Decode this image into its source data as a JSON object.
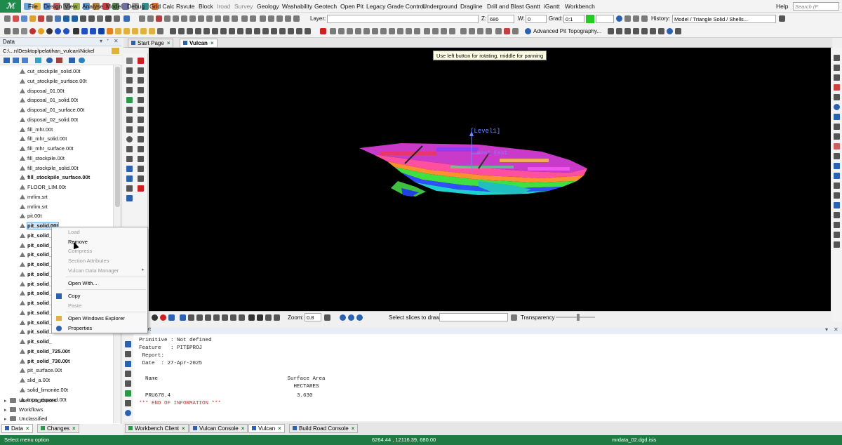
{
  "menu": {
    "items": [
      "File",
      "Design",
      "View",
      "Analyse",
      "Model",
      "Debug",
      "Grid Calc",
      "Rsvute",
      "Block",
      "Iroad",
      "Survey",
      "Geology",
      "Washability",
      "Geotech",
      "Open Pit",
      "Legacy Grade Control",
      "Underground",
      "Dragline",
      "Drill and Blast",
      "Gantt",
      "iGantt",
      "Workbench"
    ],
    "help": "Help",
    "search_placeholder": "Search (F"
  },
  "toolbar1": {
    "layer_label": "Layer:",
    "z_label": "Z:",
    "z_value": "680",
    "w_label": "W:",
    "w_value": "0",
    "grad_label": "Grad:",
    "grad_value": "0:1",
    "history_label": "History:",
    "history_value": "Model / Triangle Solid / Shells..."
  },
  "toolbar2": {
    "advanced_pit": "Advanced Pit Topography..."
  },
  "data_panel": {
    "title": "Data",
    "path": "C:\\...n\\Desktop\\pelatihan_vulcan\\Nickel",
    "files": [
      {
        "name": "cut_stockpile_solid.00t",
        "bold": false
      },
      {
        "name": "cut_stockpile_surface.00t",
        "bold": false
      },
      {
        "name": "disposal_01.00t",
        "bold": false
      },
      {
        "name": "disposal_01_solid.00t",
        "bold": false
      },
      {
        "name": "disposal_01_surface.00t",
        "bold": false
      },
      {
        "name": "disposal_02_solid.00t",
        "bold": false
      },
      {
        "name": "fill_mhr.00t",
        "bold": false
      },
      {
        "name": "fill_mhr_solid.00t",
        "bold": false
      },
      {
        "name": "fill_mhr_surface.00t",
        "bold": false
      },
      {
        "name": "fill_stockpile.00t",
        "bold": false
      },
      {
        "name": "fill_stockpile_solid.00t",
        "bold": false
      },
      {
        "name": "fill_stockpile_surface.00t",
        "bold": true
      },
      {
        "name": "FLOOR_LIM.00t",
        "bold": false
      },
      {
        "name": "mrlim.srt",
        "bold": false
      },
      {
        "name": "mrlim.srt",
        "bold": false
      },
      {
        "name": "pit.00t",
        "bold": false
      },
      {
        "name": "pit_solid.00t",
        "bold": true,
        "selected": true
      },
      {
        "name": "pit_solid_",
        "bold": true
      },
      {
        "name": "pit_solid_",
        "bold": true
      },
      {
        "name": "pit_solid_",
        "bold": true
      },
      {
        "name": "pit_solid_",
        "bold": true
      },
      {
        "name": "pit_solid_",
        "bold": true
      },
      {
        "name": "pit_solid_",
        "bold": true
      },
      {
        "name": "pit_solid_",
        "bold": true
      },
      {
        "name": "pit_solid_",
        "bold": true
      },
      {
        "name": "pit_solid_",
        "bold": true
      },
      {
        "name": "pit_solid_",
        "bold": true
      },
      {
        "name": "pit_solid_",
        "bold": true
      },
      {
        "name": "pit_solid_",
        "bold": true
      },
      {
        "name": "pit_solid_725.00t",
        "bold": true
      },
      {
        "name": "pit_solid_730.00t",
        "bold": true
      },
      {
        "name": "pit_surface.00t",
        "bold": false
      },
      {
        "name": "slid_a.00t",
        "bold": false
      },
      {
        "name": "solid_limonite.00t",
        "bold": false
      },
      {
        "name": "topo_expand.00t",
        "bold": false
      }
    ],
    "folders": [
      "User Databases",
      "Workflows",
      "Unclassified"
    ],
    "tabs": [
      "Data",
      "Changes"
    ]
  },
  "context_menu": {
    "items": [
      {
        "label": "Load",
        "disabled": true
      },
      {
        "label": "Remove",
        "disabled": false
      },
      {
        "label": "Compress",
        "disabled": true
      },
      {
        "label": "Section Attributes",
        "disabled": true
      },
      {
        "label": "Vulcan Data Manager",
        "disabled": true,
        "submenu": true
      },
      {
        "label": "Open With...",
        "disabled": false
      },
      {
        "label": "Copy",
        "disabled": false
      },
      {
        "label": "Paste",
        "disabled": true
      },
      {
        "label": "Open Windows Explorer",
        "disabled": false
      },
      {
        "label": "Properties",
        "disabled": false
      }
    ]
  },
  "doc_tabs": [
    "Start Page",
    "Vulcan"
  ],
  "viewport": {
    "tooltip": "Use left button for rotating, middle for panning",
    "level_label": "[Level1]",
    "east_label": "Hest East",
    "zoom_label": "Zoom:",
    "zoom_value": "0.8",
    "slices_label": "Select slices to draw:",
    "transparency_label": "Transparency"
  },
  "report": {
    "header": "Report",
    "lines": [
      "Primitive : Not defined",
      "Feature   : PIT$PROJ",
      " Report:",
      " Date  : 27-Apr-2025",
      "",
      "",
      "  Name                                         Surface Area",
      "                                                 HECTARES",
      "",
      "  PRU678.4                                        3.630"
    ],
    "end_line": "*** END OF INFORMATION ***"
  },
  "bottom_tabs": [
    "Workbench Client",
    "Vulcan Console",
    "Vulcan",
    "Build Road Console"
  ],
  "status": {
    "left": "Select menu option",
    "coords": "6264.44 , 12116.39, 680.00",
    "file": "mrdata_02.dgd.isis"
  },
  "colors": {
    "accent_green": "#1f7a44",
    "brand_green": "#1f8a4c"
  }
}
